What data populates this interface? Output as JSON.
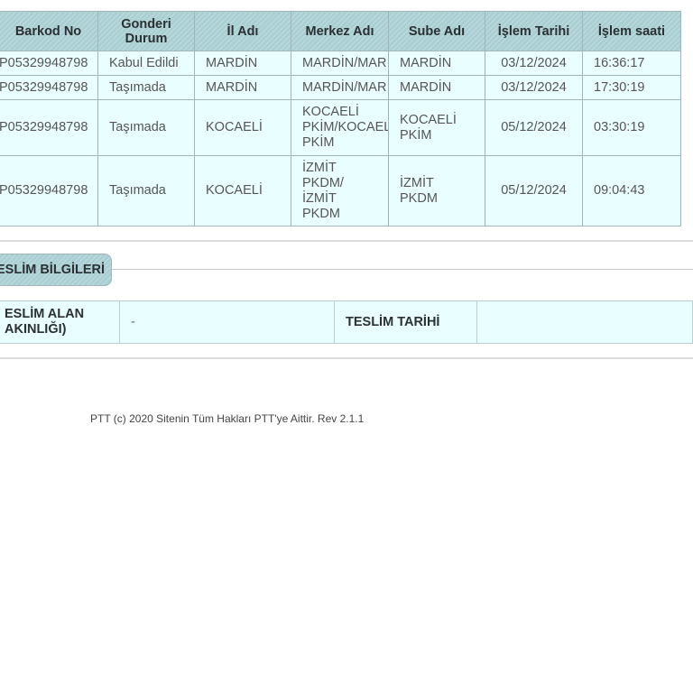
{
  "tracking_table": {
    "headers": [
      "Barkod No",
      "Gonderi Durum",
      "İl Adı",
      "Merkez Adı",
      "Sube Adı",
      "İşlem Tarihi",
      "İşlem saati"
    ],
    "rows": [
      {
        "barkod": "P05329948798",
        "durum": "Kabul Edildi",
        "il": "MARDİN",
        "merkez": [
          "MARDİN/MAR"
        ],
        "sube": [
          "MARDİN"
        ],
        "tarih": "03/12/2024",
        "saat": "16:36:17"
      },
      {
        "barkod": "P05329948798",
        "durum": "Taşımada",
        "il": "MARDİN",
        "merkez": [
          "MARDİN/MAR"
        ],
        "sube": [
          "MARDİN"
        ],
        "tarih": "03/12/2024",
        "saat": "17:30:19"
      },
      {
        "barkod": "P05329948798",
        "durum": "Taşımada",
        "il": "KOCAELİ",
        "merkez": [
          "KOCAELİ",
          "PKİM/KOCAEL",
          "PKİM"
        ],
        "sube": [
          "KOCAELİ",
          "PKİM"
        ],
        "tarih": "05/12/2024",
        "saat": "03:30:19"
      },
      {
        "barkod": "P05329948798",
        "durum": "Taşımada",
        "il": "KOCAELİ",
        "merkez": [
          "İZMİT",
          "PKDM/",
          "İZMİT",
          "PKDM"
        ],
        "sube": [
          "İZMİT",
          "PKDM"
        ],
        "tarih": "05/12/2024",
        "saat": "09:04:43"
      }
    ]
  },
  "delivery_section": {
    "title": "ESLİM BİLGİLERİ",
    "alan_label_line1": "ESLİM ALAN",
    "alan_label_line2": "AKINLIĞI)",
    "alan_value": "-",
    "tarih_label": "TESLİM TARİHİ",
    "tarih_value": ""
  },
  "footer": {
    "text": "PTT (c) 2020 Sitenin Tüm Hakları PTT'ye Aittir. Rev 2.1.1"
  }
}
